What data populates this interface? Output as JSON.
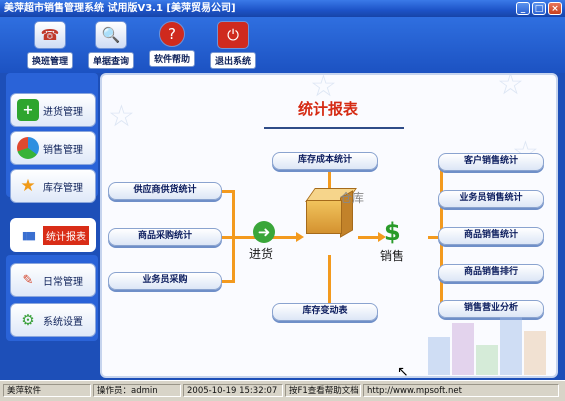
{
  "window": {
    "title": "美萍超市销售管理系统 试用版V3.1 [美萍贸易公司]",
    "buttons": [
      "_",
      "□",
      "×"
    ]
  },
  "toolbar": {
    "items": [
      {
        "label": "换班管理",
        "icon": "shift-icon"
      },
      {
        "label": "单据查询",
        "icon": "magnifier-icon"
      },
      {
        "label": "软件帮助",
        "icon": "help-icon"
      },
      {
        "label": "退出系统",
        "icon": "exit-icon"
      }
    ]
  },
  "sidebar": {
    "items": [
      {
        "label": "进货管理",
        "icon": "plus-icon"
      },
      {
        "label": "销售管理",
        "icon": "pie-icon"
      },
      {
        "label": "库存管理",
        "icon": "star-icon"
      },
      {
        "label": "统计报表",
        "icon": "bars-icon",
        "active": true
      },
      {
        "label": "日常管理",
        "icon": "pen-icon"
      },
      {
        "label": "系统设置",
        "icon": "gear-icon"
      }
    ]
  },
  "main": {
    "heading": "统计报表",
    "left": [
      "供应商供货统计",
      "商品采购统计",
      "业务员采购"
    ],
    "center": [
      "库存成本统计",
      "库存变动表"
    ],
    "right": [
      "客户销售统计",
      "业务员销售统计",
      "商品销售统计",
      "商品销售排行",
      "销售营业分析"
    ],
    "labels": {
      "purchase": "进货",
      "warehouse": "仓库",
      "sales": "销售"
    }
  },
  "statusbar": {
    "cells": [
      "美萍软件",
      "操作员：admin",
      "2005-10-19 15:32:07",
      "按F1查看帮助文档",
      "http://www.mpsoft.net"
    ]
  },
  "colors": {
    "accent": "#d52a13",
    "connector": "#f39a1e",
    "frame": "#1d4fb8"
  }
}
